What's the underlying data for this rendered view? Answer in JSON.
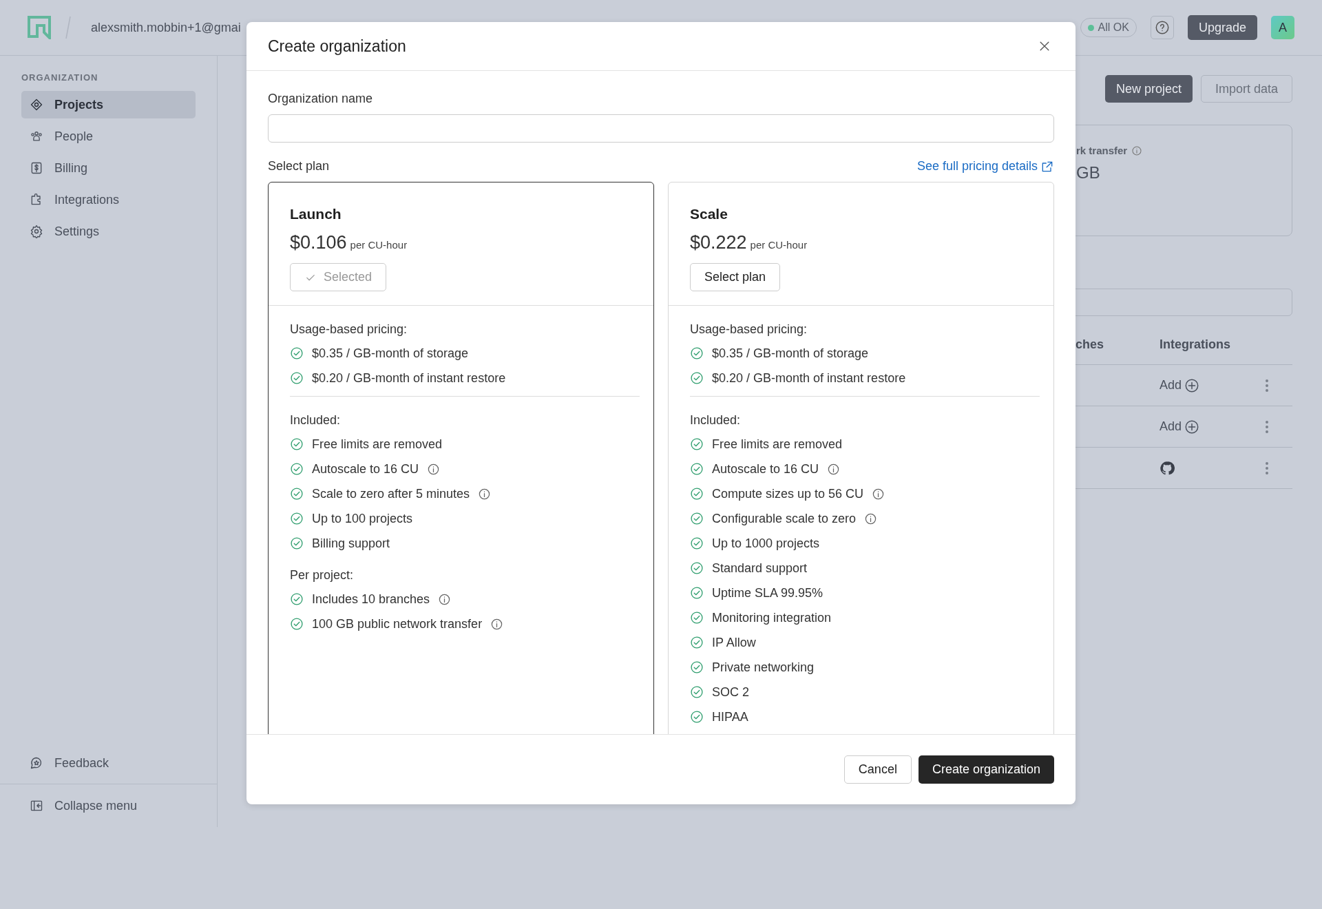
{
  "topbar": {
    "email": "alexsmith.mobbin+1@gmai",
    "status": "All OK",
    "upgrade": "Upgrade",
    "avatar": "A"
  },
  "sidebar": {
    "heading": "ORGANIZATION",
    "items": [
      {
        "label": "Projects",
        "selected": true
      },
      {
        "label": "People",
        "selected": false
      },
      {
        "label": "Billing",
        "selected": false
      },
      {
        "label": "Integrations",
        "selected": false
      },
      {
        "label": "Settings",
        "selected": false
      }
    ],
    "footer": [
      "Feedback",
      "Collapse menu"
    ]
  },
  "main": {
    "buttons": [
      "New project",
      "Import data"
    ],
    "card": {
      "label": "rk transfer",
      "value": "GB"
    },
    "table": {
      "columns": [
        "ches",
        "Integrations"
      ],
      "rows": [
        {
          "kind": "add",
          "integration": "Add"
        },
        {
          "kind": "add",
          "integration": "Add"
        },
        {
          "kind": "github"
        }
      ]
    }
  },
  "modal": {
    "title": "Create organization",
    "name_label": "Organization name",
    "plan_label": "Select plan",
    "pricing_link": "See full pricing details",
    "plans": [
      {
        "name": "Launch",
        "price": "$0.106",
        "unit": "per CU-hour",
        "selected": true,
        "button": "Selected",
        "usage": {
          "heading": "Usage-based pricing:",
          "items": [
            {
              "text": "$0.35 / GB-month of storage",
              "info": false
            },
            {
              "text": "$0.20 / GB-month of instant restore",
              "info": false
            }
          ]
        },
        "groups": [
          {
            "heading": "Included:",
            "items": [
              {
                "text": "Free limits are removed",
                "info": false
              },
              {
                "text": "Autoscale to 16 CU",
                "info": true
              },
              {
                "text": "Scale to zero after 5 minutes",
                "info": true
              },
              {
                "text": "Up to 100 projects",
                "info": false
              },
              {
                "text": "Billing support",
                "info": false
              }
            ]
          },
          {
            "heading": "Per project:",
            "items": [
              {
                "text": "Includes 10 branches",
                "info": true
              },
              {
                "text": "100 GB public network transfer",
                "info": true
              }
            ]
          }
        ]
      },
      {
        "name": "Scale",
        "price": "$0.222",
        "unit": "per CU-hour",
        "selected": false,
        "button": "Select plan",
        "usage": {
          "heading": "Usage-based pricing:",
          "items": [
            {
              "text": "$0.35 / GB-month of storage",
              "info": false
            },
            {
              "text": "$0.20 / GB-month of instant restore",
              "info": false
            }
          ]
        },
        "groups": [
          {
            "heading": "Included:",
            "items": [
              {
                "text": "Free limits are removed",
                "info": false
              },
              {
                "text": "Autoscale to 16 CU",
                "info": true
              },
              {
                "text": "Compute sizes up to 56 CU",
                "info": true
              },
              {
                "text": "Configurable scale to zero",
                "info": true
              },
              {
                "text": "Up to 1000 projects",
                "info": false
              },
              {
                "text": "Standard support",
                "info": false
              },
              {
                "text": "Uptime SLA 99.95%",
                "info": false
              },
              {
                "text": "Monitoring integration",
                "info": false
              },
              {
                "text": "IP Allow",
                "info": false
              },
              {
                "text": "Private networking",
                "info": false
              },
              {
                "text": "SOC 2",
                "info": false
              },
              {
                "text": "HIPAA",
                "info": false
              }
            ]
          }
        ]
      }
    ],
    "buttons": [
      "Cancel",
      "Create organization"
    ]
  }
}
